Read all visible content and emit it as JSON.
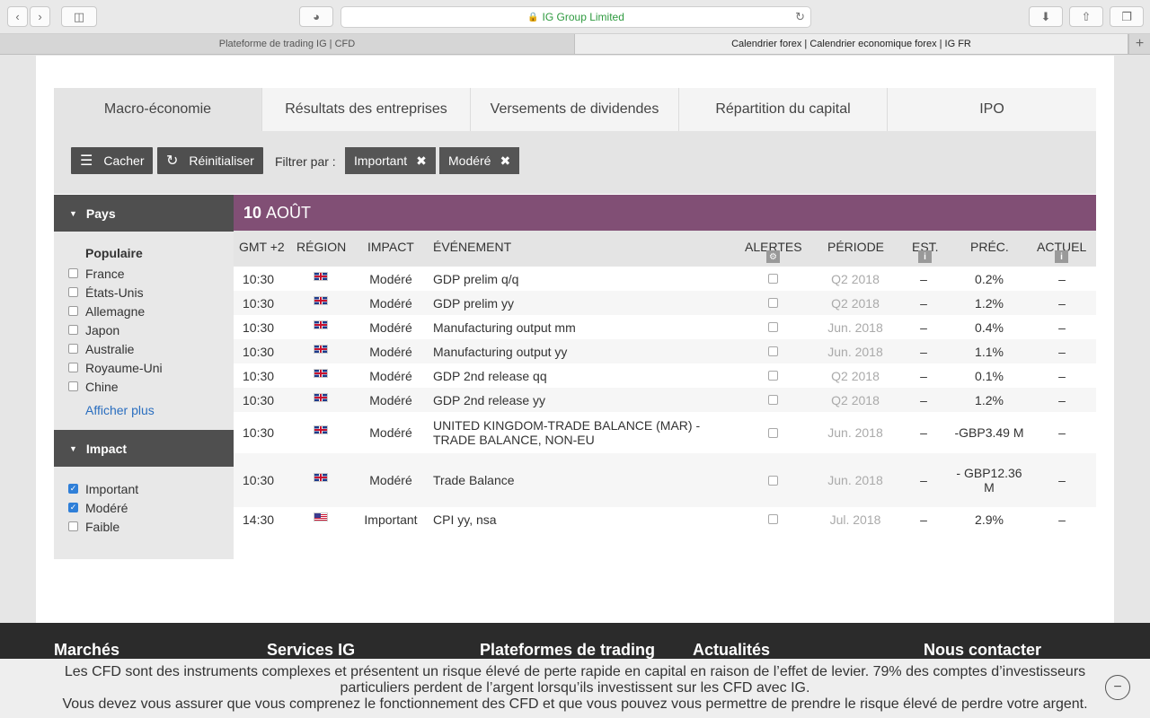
{
  "browser": {
    "url_text": "IG Group Limited",
    "tabs": [
      {
        "label": "Plateforme de trading IG | CFD"
      },
      {
        "label": "Calendrier forex | Calendrier economique forex | IG FR"
      }
    ]
  },
  "calendar_tabs": [
    {
      "label": "Macro-économie"
    },
    {
      "label": "Résultats des entreprises"
    },
    {
      "label": "Versements de dividendes"
    },
    {
      "label": "Répartition du capital"
    },
    {
      "label": "IPO"
    }
  ],
  "filterbar": {
    "hide_label": "Cacher",
    "reset_label": "Réinitialiser",
    "filter_by": "Filtrer par :",
    "chips": [
      {
        "label": "Important"
      },
      {
        "label": "Modéré"
      }
    ]
  },
  "sidebar": {
    "country_head": "Pays",
    "popular_title": "Populaire",
    "countries": [
      {
        "label": "France"
      },
      {
        "label": "États-Unis"
      },
      {
        "label": "Allemagne"
      },
      {
        "label": "Japon"
      },
      {
        "label": "Australie"
      },
      {
        "label": "Royaume-Uni"
      },
      {
        "label": "Chine"
      }
    ],
    "show_more": "Afficher plus",
    "impact_head": "Impact",
    "impacts": [
      {
        "label": "Important",
        "checked": true
      },
      {
        "label": "Modéré",
        "checked": true
      },
      {
        "label": "Faible",
        "checked": false
      }
    ]
  },
  "table": {
    "date_day": "10",
    "date_month": "AOÛT",
    "headers": {
      "time": "GMT +2",
      "region": "RÉGION",
      "impact": "IMPACT",
      "event": "ÉVÉNEMENT",
      "alerts": "ALERTES",
      "period": "PÉRIODE",
      "est": "EST.",
      "prev": "PRÉC.",
      "actual": "ACTUEL"
    },
    "rows": [
      {
        "time": "10:30",
        "region": "uk",
        "impact": "Modéré",
        "event": "GDP prelim q/q",
        "period": "Q2 2018",
        "est": "–",
        "prev": "0.2%",
        "actual": "–"
      },
      {
        "time": "10:30",
        "region": "uk",
        "impact": "Modéré",
        "event": "GDP prelim yy",
        "period": "Q2 2018",
        "est": "–",
        "prev": "1.2%",
        "actual": "–"
      },
      {
        "time": "10:30",
        "region": "uk",
        "impact": "Modéré",
        "event": "Manufacturing output mm",
        "period": "Jun. 2018",
        "est": "–",
        "prev": "0.4%",
        "actual": "–"
      },
      {
        "time": "10:30",
        "region": "uk",
        "impact": "Modéré",
        "event": "Manufacturing output yy",
        "period": "Jun. 2018",
        "est": "–",
        "prev": "1.1%",
        "actual": "–"
      },
      {
        "time": "10:30",
        "region": "uk",
        "impact": "Modéré",
        "event": "GDP 2nd release qq",
        "period": "Q2 2018",
        "est": "–",
        "prev": "0.1%",
        "actual": "–"
      },
      {
        "time": "10:30",
        "region": "uk",
        "impact": "Modéré",
        "event": "GDP 2nd release yy",
        "period": "Q2 2018",
        "est": "–",
        "prev": "1.2%",
        "actual": "–"
      },
      {
        "time": "10:30",
        "region": "uk",
        "impact": "Modéré",
        "event": "UNITED KINGDOM-TRADE BALANCE (MAR) - TRADE BALANCE, NON-EU",
        "period": "Jun. 2018",
        "est": "–",
        "prev": "-GBP3.49 M",
        "actual": "–"
      },
      {
        "time": "10:30",
        "region": "uk",
        "impact": "Modéré",
        "event": "Trade Balance",
        "period": "Jun. 2018",
        "est": "–",
        "prev": "- GBP12.36 M",
        "actual": "–"
      },
      {
        "time": "14:30",
        "region": "us",
        "impact": "Important",
        "event": "CPI yy, nsa",
        "period": "Jul. 2018",
        "est": "–",
        "prev": "2.9%",
        "actual": "–"
      }
    ]
  },
  "footer": {
    "columns": [
      {
        "label": "Marchés"
      },
      {
        "label": "Services IG"
      },
      {
        "label": "Plateformes de trading"
      },
      {
        "label": "Actualités"
      },
      {
        "label": "Nous contacter"
      }
    ],
    "warning_line1": "Les CFD sont des instruments complexes et présentent un risque élevé de perte rapide en capital en raison de l’effet de levier. 79% des comptes d’investisseurs particuliers perdent de l’argent lorsqu’ils investissent sur les CFD avec IG.",
    "warning_line2": "Vous devez vous assurer que vous comprenez le fonctionnement des CFD et que vous pouvez vous permettre de prendre le risque élevé de perdre votre argent."
  }
}
